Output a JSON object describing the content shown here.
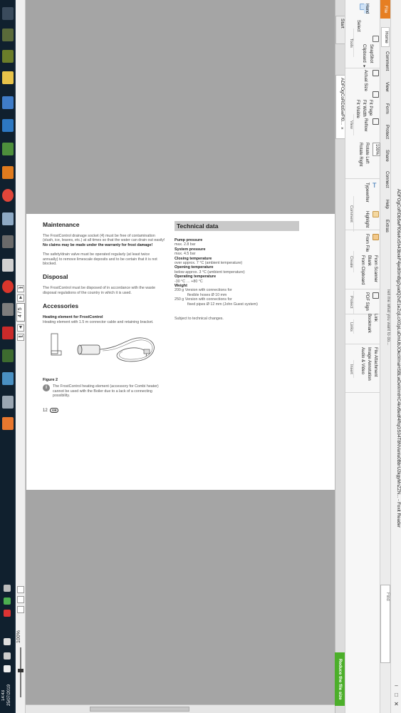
{
  "window": {
    "title": "ADFOgCoRDb5wFf06eKx5h43bxkF4jedt0mBg2yadQ2vE1eZcjLcXGpLuDmUbJOkcWnaHSBLwDeWmtHC4kvBedf4RqGS04T8NVanlu0BbrU2kgyMnZZN... - Foxit Reader",
    "controls": [
      "–",
      "□",
      "✕"
    ]
  },
  "menu_tabs": {
    "file": "File",
    "items": [
      "Home",
      "Comment",
      "View",
      "Form",
      "Protect",
      "Share",
      "Connect",
      "Help",
      "Extras"
    ],
    "tell_me": "Tell me what you want to do...",
    "search_placeholder": "Find"
  },
  "ribbon": {
    "tools": {
      "hand": "Hand",
      "select": "Select",
      "snapshot": "SnapShot",
      "clipboard": "Clipboard ▾",
      "group": "Tools"
    },
    "view": {
      "actual_size": "Actual Size",
      "fit_page": "Fit Page",
      "fit_width": "Fit Width",
      "fit_visible": "Fit Visible",
      "reflow": "Reflow",
      "zoom": "100%",
      "rotate_left": "Rotate Left",
      "rotate_right": "Rotate Right",
      "group": "View"
    },
    "comment": {
      "typewriter": "Typewriter",
      "highlight": "Highlight",
      "group": "Comment"
    },
    "create": {
      "from_file": "From File",
      "from_scanner": "From Scanner",
      "blank": "Blank",
      "from_clipboard": "From Clipboard",
      "group": "Create"
    },
    "protect": {
      "pdf_sign": "PDF Sign",
      "group": "Protect"
    },
    "links": {
      "link": "Link",
      "bookmark": "Bookmark",
      "group": "Links"
    },
    "insert": {
      "file_attachment": "File Attachment",
      "image_annotation": "Image Annotation",
      "audio_video": "Audio & Video",
      "group": "Insert"
    }
  },
  "doc_tabs": [
    {
      "label": "Start"
    },
    {
      "label": "ADFOgCoRDb5wFf0...",
      "close": "×"
    }
  ],
  "reduce_button": "Reduce the file size",
  "navigation": {
    "page": "4 / 5",
    "zoom": "100%"
  },
  "taskbar": {
    "time": "14:43",
    "date": "25/07/2019"
  },
  "page": {
    "maintenance": {
      "heading": "Maintenance",
      "p1_pre": "The FrostControl drainage socket (4) must be free of contamination (slush, ice, leaves, etc.) at all times so that the water can drain out easily! ",
      "p1_bold": "No claims may be made under the warranty for frost damage!",
      "p2": "The safety/drain valve must be operated regularly (at least twice annually) to remove limescale deposits and to be certain that it is not blocked."
    },
    "disposal": {
      "heading": "Disposal",
      "p1": "The FrostControl must be disposed of in accordance with the waste disposal regulations of the country in which it is used."
    },
    "accessories": {
      "heading": "Accessories",
      "item_title": "Heating element for FrostControl",
      "item_desc": "Heating element with 1.5 m connector cable and retaining bracket.",
      "figure_caption": "Figure 2",
      "note": "The FrostControl heating element (accessory for Combi heater) cannot be used with the Boiler due to a lack of a connecting possibility."
    },
    "technical": {
      "heading": "Technical data",
      "specs": [
        {
          "label": "Pump pressure",
          "lines": [
            "max. 2.8 bar"
          ]
        },
        {
          "label": "System pressure",
          "lines": [
            "max. 4.5 bar"
          ]
        },
        {
          "label": "Closing temperature",
          "lines": [
            "over approx. 7 °C (ambient temperature)"
          ]
        },
        {
          "label": "Opening temperature",
          "lines": [
            "below approx. 3 °C (ambient temperature)"
          ]
        },
        {
          "label": "Operating temperature",
          "lines": [
            "-30 °C … +80 °C"
          ]
        },
        {
          "label": "Weight",
          "lines": [
            "200 g Version with connections for"
          ]
        }
      ],
      "weight_l2": "flexible hoses Ø 10 mm",
      "weight_l3": "250 g Version with connections for",
      "weight_l4": "fixed pipes Ø 12 mm (John Guest system)",
      "subject": "Subject to technical changes."
    },
    "page_number": "12",
    "lang_badge": "GB"
  }
}
